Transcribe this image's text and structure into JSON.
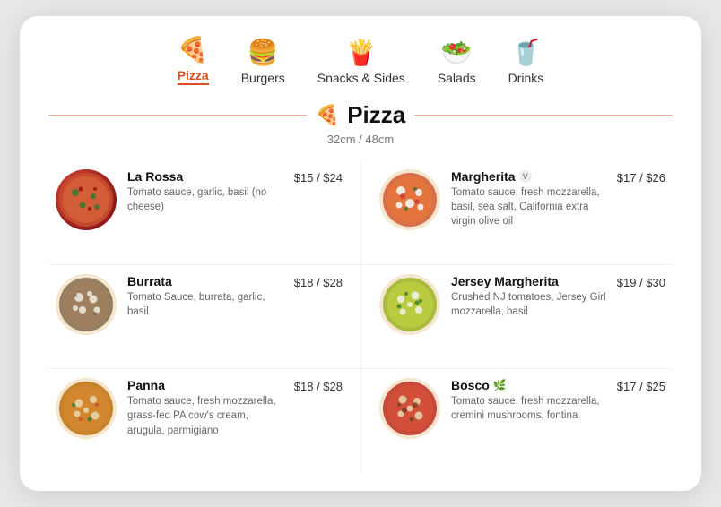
{
  "nav": {
    "items": [
      {
        "id": "pizza",
        "label": "Pizza",
        "icon": "🍕",
        "active": true
      },
      {
        "id": "burgers",
        "label": "Burgers",
        "icon": "🍔",
        "active": false
      },
      {
        "id": "snacks",
        "label": "Snacks & Sides",
        "icon": "🍟",
        "active": false
      },
      {
        "id": "salads",
        "label": "Salads",
        "icon": "🥗",
        "active": false
      },
      {
        "id": "drinks",
        "label": "Drinks",
        "icon": "🥤",
        "active": false
      }
    ]
  },
  "section": {
    "icon": "🍕",
    "title": "Pizza",
    "subtitle": "32cm / 48cm"
  },
  "menu_items": [
    {
      "id": "la-rossa",
      "name": "La Rossa",
      "description": "Tomato sauce, garlic, basil (no cheese)",
      "price": "$15 / $24",
      "badge": "",
      "emoji": "🍕",
      "bg": "#c0392b"
    },
    {
      "id": "margherita",
      "name": "Margherita",
      "description": "Tomato sauce, fresh mozzarella, basil, sea salt, California extra virgin olive oil",
      "price": "$17 / $26",
      "badge": "V",
      "emoji": "🍕",
      "bg": "#e74c3c"
    },
    {
      "id": "burrata",
      "name": "Burrata",
      "description": "Tomato Sauce, burrata, garlic, basil",
      "price": "$18 / $28",
      "badge": "",
      "emoji": "🍕",
      "bg": "#8B7355"
    },
    {
      "id": "jersey-margherita",
      "name": "Jersey Margherita",
      "description": "Crushed NJ tomatoes, Jersey Girl mozzarella, basil",
      "price": "$19 / $30",
      "badge": "",
      "emoji": "🍕",
      "bg": "#2ecc71"
    },
    {
      "id": "panna",
      "name": "Panna",
      "description": "Tomato sauce, fresh mozzarella, grass-fed PA cow's cream, arugula, parmigiano",
      "price": "$18 / $28",
      "badge": "",
      "emoji": "🍕",
      "bg": "#e67e22"
    },
    {
      "id": "bosco",
      "name": "Bosco",
      "description": "Tomato sauce, fresh mozzarella, cremini mushrooms, fontina",
      "price": "$17 / $25",
      "badge": "leaf",
      "emoji": "🍕",
      "bg": "#c0392b"
    }
  ]
}
